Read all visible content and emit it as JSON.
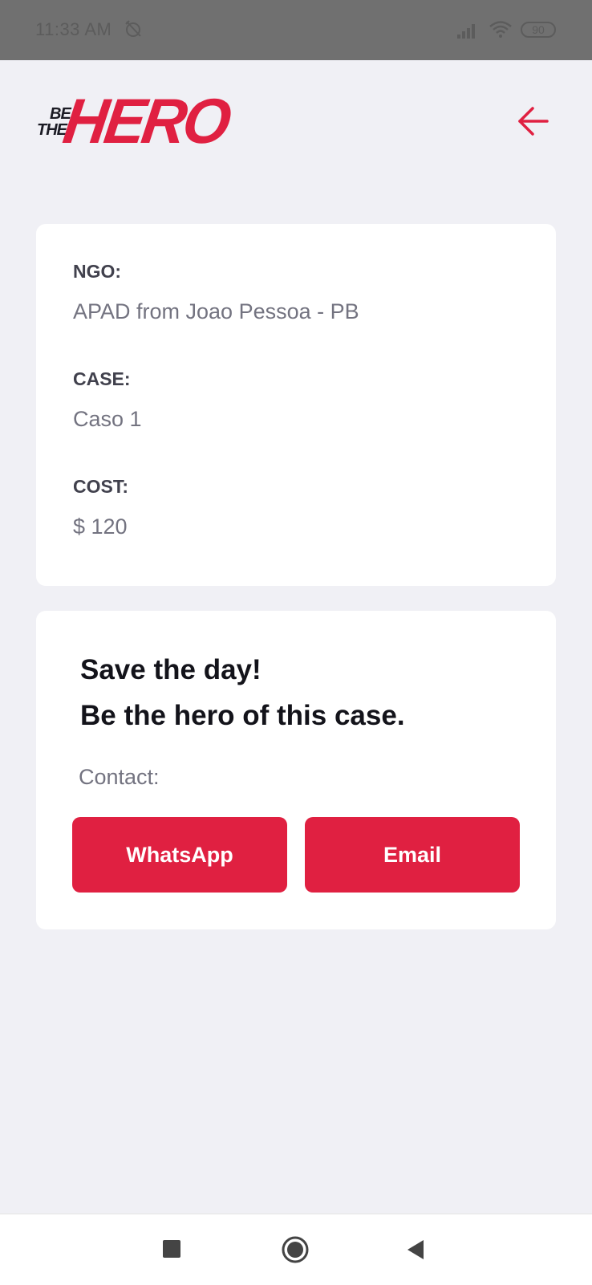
{
  "status_bar": {
    "time": "11:33 AM",
    "battery": "90",
    "alarm_icon": "alarm-off-icon",
    "signal_icon": "signal-icon",
    "wifi_icon": "wifi-icon"
  },
  "header": {
    "logo": {
      "line1": "BE",
      "line2": "THE",
      "main": "HERO"
    },
    "back_icon": "arrow-left-icon"
  },
  "incident": {
    "fields": [
      {
        "label": "NGO:",
        "value": "APAD from Joao Pessoa - PB"
      },
      {
        "label": "CASE:",
        "value": "Caso 1"
      },
      {
        "label": "COST:",
        "value": "$ 120"
      }
    ]
  },
  "contact_box": {
    "title_line1": "Save the day!",
    "title_line2": "Be the hero of this case.",
    "contact_label": "Contact:",
    "actions": [
      {
        "label": "WhatsApp"
      },
      {
        "label": "Email"
      }
    ]
  },
  "nav_bar": {
    "icons": [
      "recents-square-icon",
      "home-circle-icon",
      "back-triangle-icon"
    ]
  },
  "colors": {
    "accent": "#e02041",
    "background": "#f0f0f5",
    "card": "#ffffff",
    "label": "#41414d",
    "value": "#737380"
  }
}
